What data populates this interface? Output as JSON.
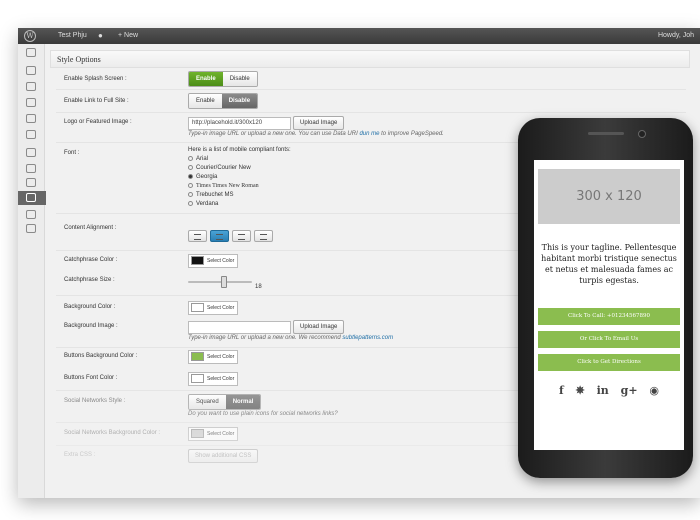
{
  "adminbar": {
    "site_name": "Test Phju",
    "comment_icon": "comment-icon",
    "new_label": "+ New",
    "howdy": "Howdy, Joh"
  },
  "section": {
    "title": "Style Options"
  },
  "splash": {
    "label": "Enable Splash Screen :",
    "enable": "Enable",
    "disable": "Disable",
    "selected": "Enable"
  },
  "fullsite": {
    "label": "Enable Link to Full Site :",
    "enable": "Enable",
    "disable": "Disable",
    "selected": "Disable"
  },
  "logo": {
    "label": "Logo or Featured Image :",
    "value": "http://placehold.it/300x120",
    "upload": "Upload Image",
    "hint_pre": "Type-in image URL or upload a new one. You can use Data URI",
    "hint_link": "dun me",
    "hint_post": "to improve PageSpeed."
  },
  "font": {
    "label": "Font :",
    "intro": "Here is a list of mobile compliant fonts:",
    "options": [
      "Arial",
      "Courier/Courier New",
      "Georgia",
      "Times Times New Roman",
      "Trebuchet MS",
      "Verdana"
    ],
    "selected": "Georgia"
  },
  "alignment": {
    "label": "Content Alignment :",
    "options": [
      "left",
      "center",
      "right",
      "justify"
    ],
    "selected": "center"
  },
  "catchphrase_color": {
    "label": "Catchphrase Color :",
    "button": "Select Color",
    "value": "#111111"
  },
  "catchphrase_size": {
    "label": "Catchphrase Size :",
    "value": "18",
    "fraction": 0.55
  },
  "bg_color": {
    "label": "Background Color :",
    "button": "Select Color",
    "value": "#ffffff"
  },
  "bg_image": {
    "label": "Background Image :",
    "value": "",
    "upload": "Upload Image",
    "hint_pre": "Type-in image URL or upload a new one. We recommend",
    "hint_link": "subtlepatterns.com"
  },
  "buttons_bg": {
    "label": "Buttons Background Color :",
    "button": "Select Color",
    "value": "#8bbd4f"
  },
  "buttons_font": {
    "label": "Buttons Font Color :",
    "button": "Select Color",
    "value": "#ffffff"
  },
  "social_style": {
    "label": "Social Networks Style :",
    "squared": "Squared",
    "normal": "Normal",
    "selected": "Normal",
    "hint": "Do you want to use plain icons for social networks links?"
  },
  "social_bg": {
    "label": "Social Networks Background Color :",
    "button": "Select Color",
    "value": "#cccccc"
  },
  "extra_css": {
    "label": "Extra CSS :",
    "button": "Show additional CSS"
  },
  "phone": {
    "image_text": "300 x 120",
    "tagline": "This is your tagline. Pellentesque habitant morbi tristique senectus et netus et malesuada fames ac turpis egestas.",
    "buttons": [
      "Click To Call: +01234567890",
      "Or Click To Email Us",
      "Click to Get Directions"
    ],
    "social": [
      "f",
      "t",
      "in",
      "g+",
      "gh"
    ],
    "button_color": "#8bbd4f"
  },
  "colors": {
    "adminbar": "#464646",
    "accent_green": "#5fa022",
    "link": "#1e6ea6"
  }
}
